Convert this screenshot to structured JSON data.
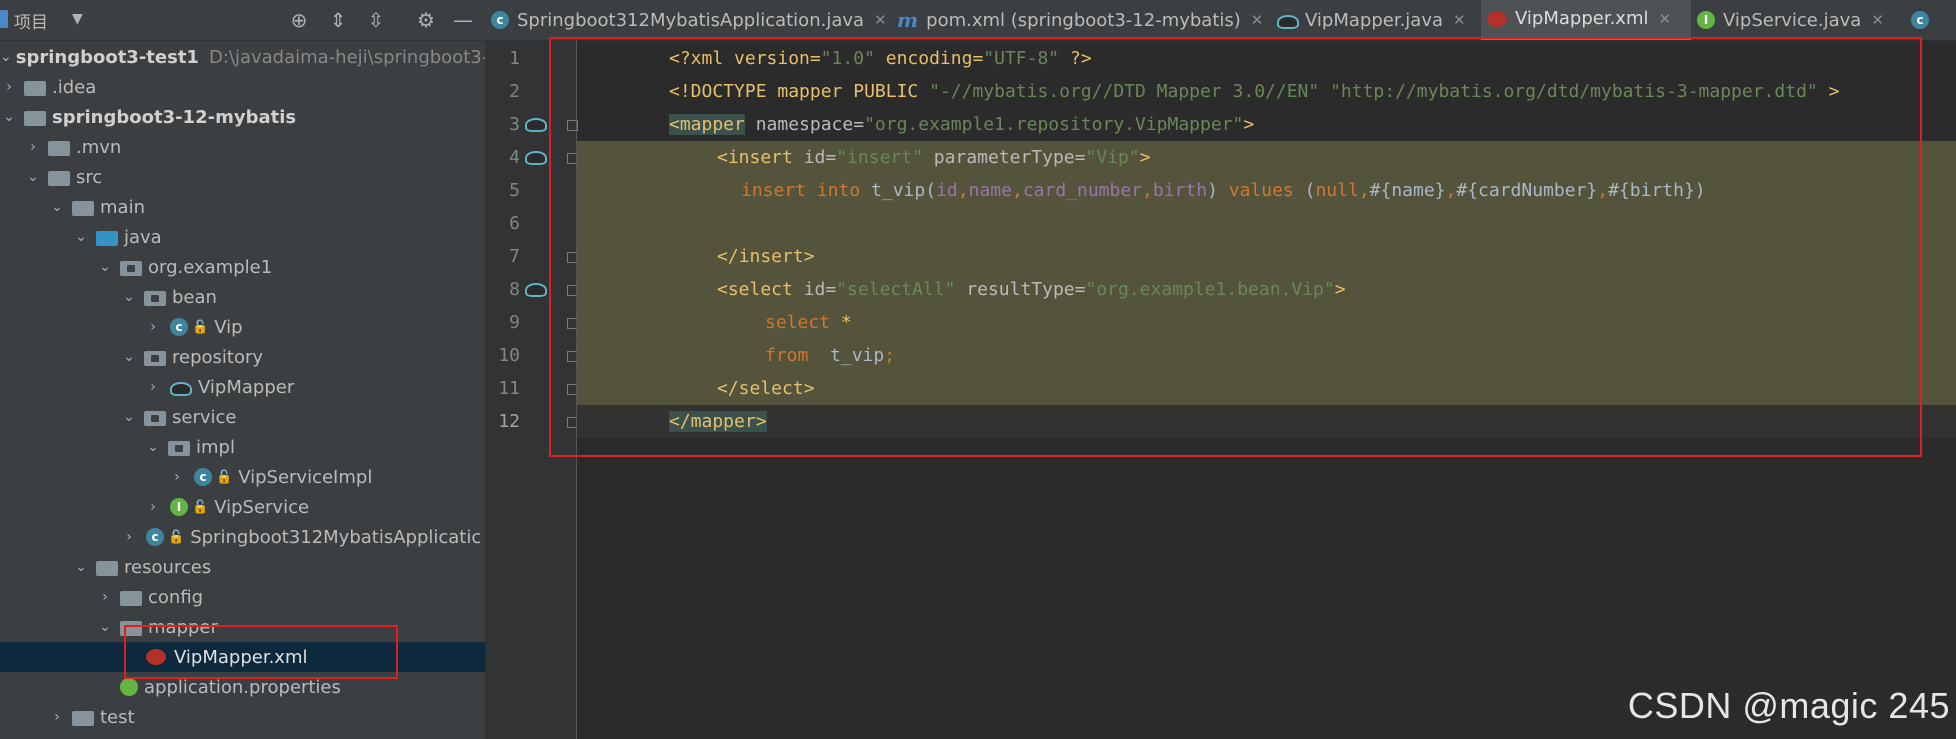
{
  "project_panel": {
    "title": "项目",
    "tree": [
      {
        "label": "springboot3-test1",
        "path": "D:\\javadaima-heji\\springboot3-t",
        "bold": true,
        "expanded": true
      },
      {
        "label": ".idea"
      },
      {
        "label": "springboot3-12-mybatis",
        "bold": true
      },
      {
        "label": ".mvn"
      },
      {
        "label": "src"
      },
      {
        "label": "main"
      },
      {
        "label": "java"
      },
      {
        "label": "org.example1"
      },
      {
        "label": "bean"
      },
      {
        "label": "Vip"
      },
      {
        "label": "repository"
      },
      {
        "label": "VipMapper"
      },
      {
        "label": "service"
      },
      {
        "label": "impl"
      },
      {
        "label": "VipServiceImpl"
      },
      {
        "label": "VipService"
      },
      {
        "label": "Springboot312MybatisApplicatic"
      },
      {
        "label": "resources"
      },
      {
        "label": "config"
      },
      {
        "label": "mapper"
      },
      {
        "label": "VipMapper.xml"
      },
      {
        "label": "application.properties"
      },
      {
        "label": "test"
      }
    ]
  },
  "tabs": [
    {
      "label": "Springboot312MybatisApplication.java"
    },
    {
      "label": "pom.xml (springboot3-12-mybatis)"
    },
    {
      "label": "VipMapper.java"
    },
    {
      "label": "VipMapper.xml"
    },
    {
      "label": "VipService.java"
    }
  ],
  "line_numbers": [
    "1",
    "2",
    "3",
    "4",
    "5",
    "6",
    "7",
    "8",
    "9",
    "10",
    "11",
    "12"
  ],
  "code": {
    "l1": {
      "a": "<?xml version=",
      "b": "\"1.0\"",
      "c": " encoding=",
      "d": "\"UTF-8\"",
      "e": " ?>"
    },
    "l2": {
      "a": "<!DOCTYPE mapper PUBLIC ",
      "b": "\"-//mybatis.org//DTD Mapper 3.0//EN\"",
      "c": " ",
      "d": "\"http://mybatis.org/dtd/mybatis-3-mapper.dtd\"",
      "e": " >"
    },
    "l3": {
      "a": "<mapper",
      "b": " namespace=",
      "c": "\"org.example1.repository.VipMapper\"",
      "d": ">"
    },
    "l4": {
      "a": "<insert",
      "b": " id=",
      "c": "\"insert\"",
      "d": " parameterType=",
      "e": "\"Vip\"",
      "f": ">"
    },
    "l5": {
      "a": "insert into ",
      "b": "t_vip(",
      "c": "id",
      "d": ",",
      "e": "name",
      "f": "card_number",
      "g": "birth",
      "h": ") ",
      "i": "values ",
      "j": "(",
      "k": "null",
      "l": "#{name}",
      "m": "#{cardNumber}",
      "n": "#{birth}",
      "o": ")"
    },
    "l7": {
      "a": "</insert>"
    },
    "l8": {
      "a": "<select",
      "b": " id=",
      "c": "\"selectAll\"",
      "d": " resultType=",
      "e": "\"org.example1.bean.Vip\"",
      "f": ">"
    },
    "l9": {
      "a": "select ",
      "b": "*"
    },
    "l10": {
      "a": "from",
      "b": "  t_vip",
      "c": ";"
    },
    "l11": {
      "a": "</select>"
    },
    "l12": {
      "a": "</mapper>"
    }
  },
  "watermark": "CSDN @magic 245"
}
